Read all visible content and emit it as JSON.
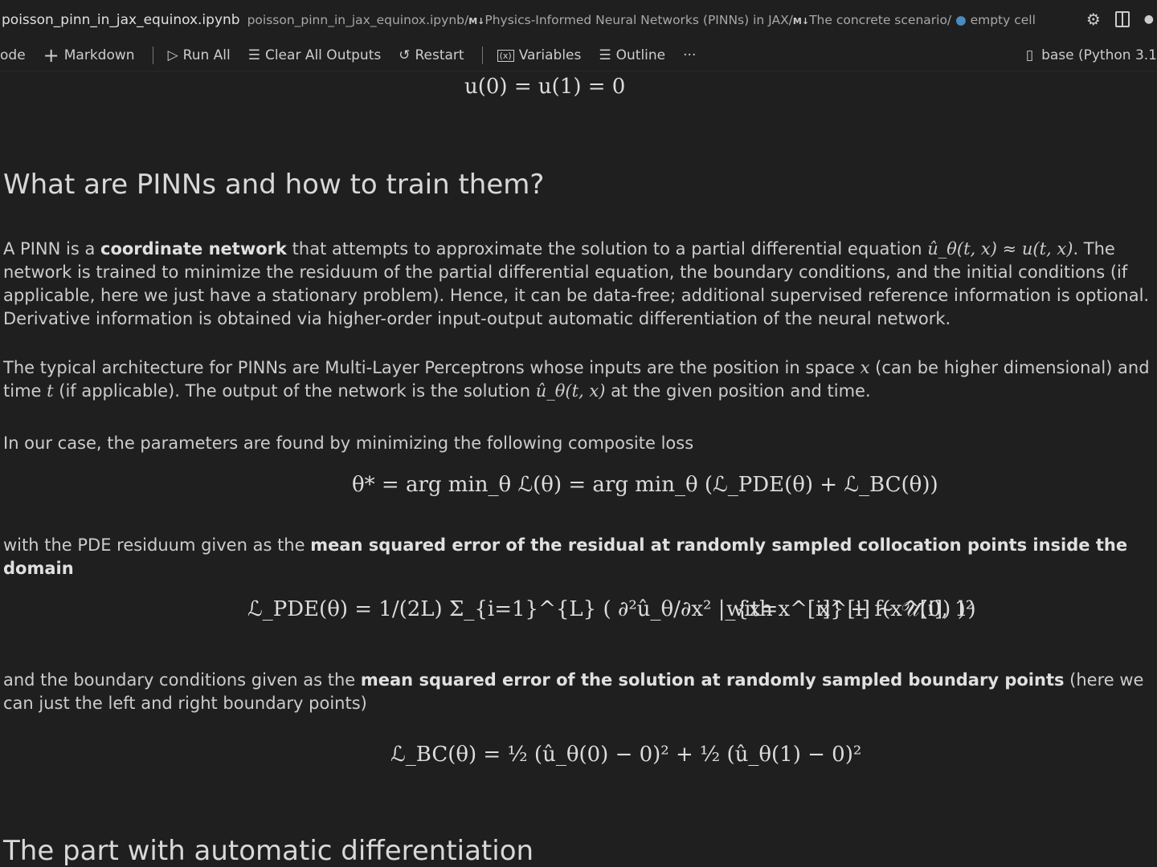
{
  "titlebar": {
    "filename": "poisson_pinn_in_jax_equinox.ipynb",
    "breadcrumb": [
      {
        "text": "poisson_pinn_in_jax_equinox.ipynb/"
      },
      {
        "badge": "M↓",
        "text": "Physics-Informed Neural Networks (PINNs) in JAX/"
      },
      {
        "badge": "M↓",
        "text": "The concrete scenario/"
      },
      {
        "text": "empty cell"
      }
    ],
    "icons": [
      "gear-icon",
      "split-editor-icon",
      "dot-icon"
    ]
  },
  "toolbar": {
    "code": "ode",
    "markdown": "Markdown",
    "run_all": "Run All",
    "clear": "Clear All Outputs",
    "restart": "Restart",
    "variables": "Variables",
    "outline": "Outline",
    "more": "···",
    "kernel": "base (Python 3.1"
  },
  "cell": {
    "eq_bc": "u(0) = u(1) = 0",
    "heading1": "What are PINNs and how to train them?",
    "p1a": "A PINN is a ",
    "p1b": "coordinate network",
    "p1c": " that attempts to approximate the solution to a partial differential equation ",
    "p1m": "û_θ(t, x) ≈ u(t, x)",
    "p1d": ". The network is trained to minimize the residuum of the partial differential equation, the boundary conditions, and the initial conditions (if applicable, here we just have a stationary problem). Hence, it can be data-free; additional supervised reference information is optional. Derivative information is obtained via higher-order input-output automatic differentiation of the neural network.",
    "p2a": "The typical architecture for PINNs are Multi-Layer Perceptrons whose inputs are the position in space ",
    "p2m1": "x",
    "p2b": " (can be higher dimensional) and time ",
    "p2m2": "t",
    "p2c": " (if applicable). The output of the network is the solution ",
    "p2m3": "û_θ(t, x)",
    "p2d": " at the given position and time.",
    "p3": "In our case, the parameters are found by minimizing the following composite loss",
    "eq_loss": "θ* = arg min_θ ℒ(θ) = arg min_θ (ℒ_PDE(θ) + ℒ_BC(θ))",
    "p4a": "with the PDE residuum given as the ",
    "p4b": "mean squared error of the residual at randomly sampled collocation points inside the domain",
    "eq_pde": "ℒ_PDE(θ) = 1/(2L) Σ_{i=1}^{L} ( ∂²û_θ/∂x² |_{x=x^[i]} + f(x^[i]) )²",
    "eq_pde_with": "with",
    "eq_pde_dist": "x^[i] ~ 𝒰(0, 1)",
    "p5a": "and the boundary conditions given as the ",
    "p5b": "mean squared error of the solution at randomly sampled boundary points",
    "p5c": " (here we can just the left and right boundary points)",
    "eq_bcloss": "ℒ_BC(θ) = ½ (û_θ(0) − 0)² + ½ (û_θ(1) − 0)²",
    "heading2": "The part with automatic differentiation"
  }
}
